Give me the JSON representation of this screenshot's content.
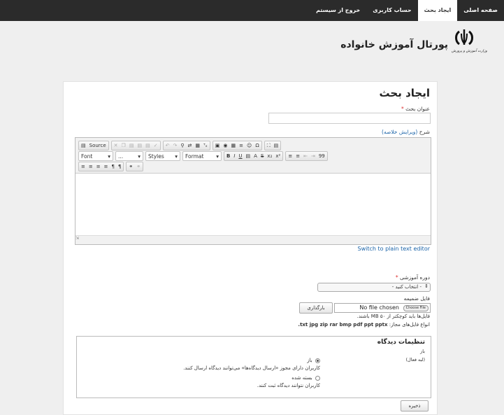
{
  "nav": {
    "items": [
      "صفحه اصلی",
      "ایجاد بحث",
      "حساب کاربری",
      "خروج از سیستم"
    ],
    "active_index": 1
  },
  "header": {
    "portal_title": "پورتال آموزش خانواده",
    "ministry_caption": "وزارت آموزش و پرورش"
  },
  "form": {
    "page_title": "ایجاد بحث",
    "title_label": "عنوان بحث",
    "required_mark": "*",
    "description_label": "شرح",
    "description_edit_link": "(ویرایش خلاصه)",
    "editor": {
      "source_label": "Source",
      "font_label": "Font",
      "size_label": "...",
      "styles_label": "Styles",
      "format_label": "Format",
      "bold": "B",
      "italic": "I",
      "underline": "U",
      "strike": "S",
      "subscript": "x₂",
      "superscript": "x²",
      "quote": "99",
      "status_text": "",
      "switch_label": "Switch to plain text editor"
    },
    "course_label": "دوره آموزشی",
    "course_select_value": "- انتخاب کنید -",
    "attachment_label": "فایل ضمیمه",
    "choose_file_label": "Choose File",
    "no_file_text": "No file chosen",
    "upload_button": "بارگذاری",
    "file_size_note": "فایل‌ها باید کوچکتر از ۵۰ MB باشند.",
    "file_types_prefix": "انواع فایل‌های مجاز:",
    "file_types": "txt jpg zip rar bmp pdf ppt pptx.",
    "settings": {
      "title": "تنظیمات دیدگاه",
      "status_label": "باز",
      "status_hint": "(لبه فعال)",
      "option_open_label": "باز",
      "option_open_desc": "کاربران دارای مجوز «ارسال دیدگاه‌ها» می‌توانند دیدگاه ارسال کنند.",
      "option_closed_label": "بسته شده",
      "option_closed_desc": "کاربران نتوانند دیدگاه ثبت کنند.",
      "selected": "open"
    },
    "save_button": "ذخیره"
  }
}
